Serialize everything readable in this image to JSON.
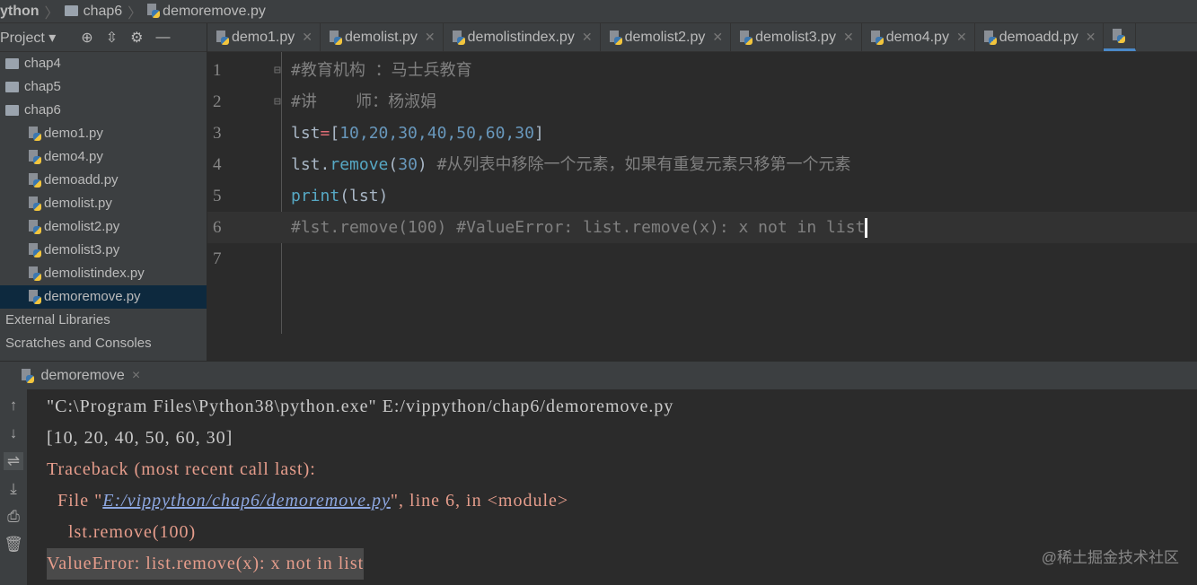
{
  "breadcrumb": {
    "project": "ython",
    "folder": "chap6",
    "file": "demoremove.py"
  },
  "sidebar": {
    "title": "Project",
    "items": [
      {
        "label": "chap4",
        "type": "folder"
      },
      {
        "label": "chap5",
        "type": "folder"
      },
      {
        "label": "chap6",
        "type": "folder"
      },
      {
        "label": "demo1.py",
        "type": "file"
      },
      {
        "label": "demo4.py",
        "type": "file"
      },
      {
        "label": "demoadd.py",
        "type": "file"
      },
      {
        "label": "demolist.py",
        "type": "file"
      },
      {
        "label": "demolist2.py",
        "type": "file"
      },
      {
        "label": "demolist3.py",
        "type": "file"
      },
      {
        "label": "demolistindex.py",
        "type": "file"
      },
      {
        "label": "demoremove.py",
        "type": "file",
        "selected": true
      }
    ],
    "external": "External Libraries",
    "scratches": "Scratches and Consoles"
  },
  "tabs": [
    "demo1.py",
    "demolist.py",
    "demolistindex.py",
    "demolist2.py",
    "demolist3.py",
    "demo4.py",
    "demoadd.py"
  ],
  "editor": {
    "lines": [
      {
        "n": "1",
        "c1": "#教育机构 ：马士兵教育"
      },
      {
        "n": "2",
        "c1": "#讲    师：杨淑娟"
      },
      {
        "n": "3",
        "a": "lst",
        "b": "=",
        "c": "[",
        "d": "10,20,30,40,50,60,30",
        "e": "]"
      },
      {
        "n": "4",
        "a": "lst.",
        "f": "remove",
        "g": "(",
        "h": "30",
        "i": ") ",
        "j": "#从列表中移除一个元素，如果有重复元素只移第一个元素"
      },
      {
        "n": "5",
        "f": "print",
        "g": "(lst)"
      },
      {
        "n": "6",
        "c1": "#lst.remove(100) #ValueError: list.remove(x): x not in list"
      },
      {
        "n": "7"
      }
    ]
  },
  "console": {
    "tab": "demoremove",
    "lines": {
      "cmd": "\"C:\\Program Files\\Python38\\python.exe\" E:/vippython/chap6/demoremove.py",
      "out": "[10, 20, 40, 50, 60, 30]",
      "tb": "Traceback (most recent call last):",
      "file_pre": "  File \"",
      "file_link": "E:/vippython/chap6/demoremove.py",
      "file_post": "\", line 6, in <module>",
      "code": "    lst.remove(100)",
      "err": "ValueError: list.remove(x): x not in list"
    }
  },
  "watermark": "@稀土掘金技术社区"
}
